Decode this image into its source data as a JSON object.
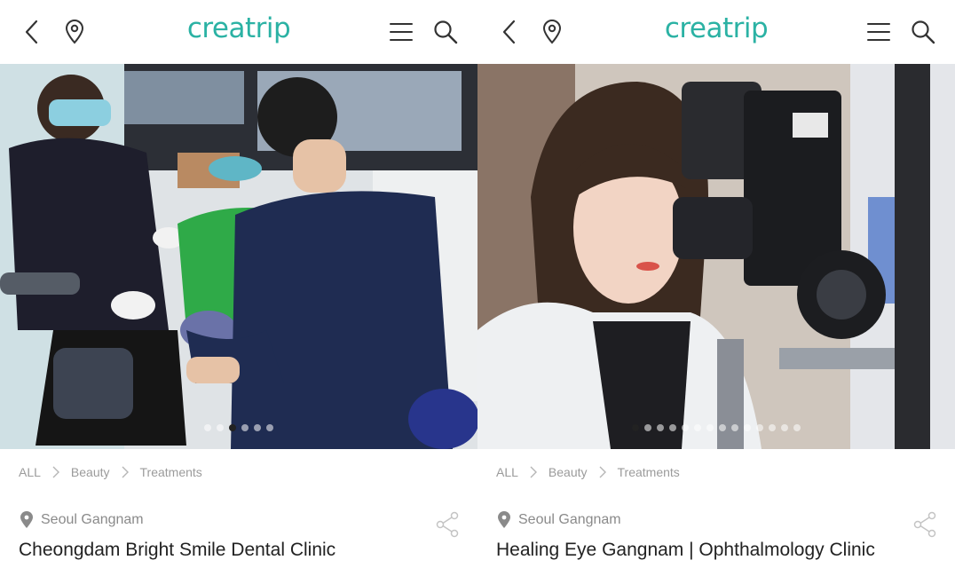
{
  "panels": [
    {
      "logo": "creatrip",
      "breadcrumb": [
        "ALL",
        "Beauty",
        "Treatments"
      ],
      "location": "Seoul Gangnam",
      "title": "Cheongdam Bright Smile Dental Clinic",
      "carousel": {
        "count": 6,
        "active": 2
      }
    },
    {
      "logo": "creatrip",
      "breadcrumb": [
        "ALL",
        "Beauty",
        "Treatments"
      ],
      "location": "Seoul Gangnam",
      "title": "Healing Eye Gangnam | Ophthalmology Clinic",
      "carousel": {
        "count": 14,
        "active": 0
      }
    }
  ],
  "icons": {
    "back": "chevron-left-icon",
    "location": "map-pin-icon",
    "menu": "hamburger-menu-icon",
    "search": "search-icon",
    "share": "share-icon",
    "breadcrumb_separator": "chevron-right-icon"
  },
  "colors": {
    "brand": "#2bb2a4",
    "text": "#222222",
    "muted": "#9b9b9b",
    "dot_active": "#222222"
  }
}
